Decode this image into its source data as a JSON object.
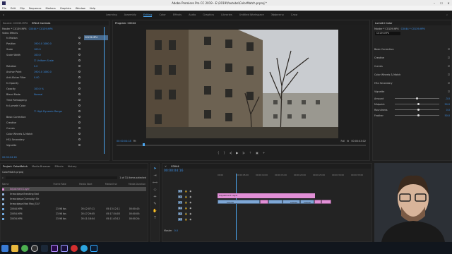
{
  "window": {
    "title": "Adobe Premiere Pro CC 2019 - E:\\2019\\Youtube\\ColorMatch.prproj *"
  },
  "menu": [
    "File",
    "Edit",
    "Clip",
    "Sequence",
    "Markers",
    "Graphics",
    "Window",
    "Help"
  ],
  "workspaces": {
    "items": [
      "Learning",
      "Assembly",
      "Editing",
      "Color",
      "Effects",
      "Audio",
      "Graphics",
      "Libraries",
      "Untitled Workspace",
      "Эффекты",
      "Слои"
    ],
    "active_index": 2
  },
  "effect_controls": {
    "tabs": [
      "Source: C0033.MP4",
      "Effect Controls",
      "Audio Clip Mixer: C0044",
      "Metadata"
    ],
    "master": "Master * C0139.MP4",
    "sequence": "C0044 * C0139.MP4",
    "clip_label": "C0139.MP4",
    "section": "Video Effects",
    "rows": [
      {
        "name": "fx Motion",
        "value": ""
      },
      {
        "name": "Position",
        "value": "1920.0   1080.0"
      },
      {
        "name": "Scale",
        "value": "100.0"
      },
      {
        "name": "Scale Width",
        "value": "100.0"
      },
      {
        "name": "",
        "value": "☑ Uniform Scale"
      },
      {
        "name": "Rotation",
        "value": "0.0"
      },
      {
        "name": "Anchor Point",
        "value": "1920.0   1080.0"
      },
      {
        "name": "Anti-flicker Filter",
        "value": "0.00"
      },
      {
        "name": "fx Opacity",
        "value": ""
      },
      {
        "name": "Opacity",
        "value": "100.0 %"
      },
      {
        "name": "Blend Mode",
        "value": "Normal"
      },
      {
        "name": "Time Remapping",
        "value": ""
      },
      {
        "name": "fx Lumetri Color",
        "value": ""
      },
      {
        "name": "",
        "value": "☐ High Dynamic Range"
      },
      {
        "name": "Basic Correction",
        "value": ""
      },
      {
        "name": "Creative",
        "value": ""
      },
      {
        "name": "Curves",
        "value": ""
      },
      {
        "name": "Color Wheels & Match",
        "value": ""
      },
      {
        "name": "HSL Secondary",
        "value": ""
      },
      {
        "name": "Vignette",
        "value": ""
      }
    ],
    "timecode": "00:00:04:18"
  },
  "program_monitor": {
    "title": "Program: C0044",
    "timecode_left": "00:00:04:18",
    "fit": "Fit",
    "quality": "Full",
    "timecode_right": "00:00:43:02"
  },
  "lumetri": {
    "title": "Lumetri Color",
    "master": "Master * C0139.MP4",
    "seq": "C0044 * C0139.MP4",
    "clip": "C0139.MP4",
    "sections": [
      "Basic Correction",
      "Creative",
      "Curves",
      "Color Wheels & Match",
      "HSL Secondary",
      "Vignette"
    ],
    "vignette": [
      {
        "label": "Amount",
        "value": "-3.0",
        "pos": 0.47
      },
      {
        "label": "Midpoint",
        "value": "50.0",
        "pos": 0.5
      },
      {
        "label": "Roundness",
        "value": "0.0",
        "pos": 0.5
      },
      {
        "label": "Feather",
        "value": "50.0",
        "pos": 0.5
      }
    ]
  },
  "project": {
    "tabs": [
      "Project: ColorMatch",
      "Media Browser",
      "Effects",
      "History"
    ],
    "file": "ColorMatch.prproj",
    "count": "1 of 31 items selected",
    "columns": [
      "Name",
      "Frame Rate",
      "Media Start",
      "Media End",
      "Media Duration"
    ],
    "items": [
      {
        "name": "Adjustment Layer",
        "rate": "",
        "start": "",
        "end": "",
        "dur": "",
        "color": "#e08ad4"
      },
      {
        "name": "Атмосфера Breaking Bad",
        "rate": "",
        "start": "",
        "end": "",
        "dur": "",
        "color": "#8fb3d9"
      },
      {
        "name": "Атмосфера Chernobyl Str",
        "rate": "",
        "start": "",
        "end": "",
        "dur": "",
        "color": "#8fb3d9"
      },
      {
        "name": "Атмосфера Mad Max_EX-F",
        "rate": "",
        "start": "",
        "end": "",
        "dur": "",
        "color": "#8fb3d9"
      },
      {
        "name": "C0044.MP4",
        "rate": "23.98 fps",
        "start": "05:12:07:11",
        "end": "05:13:12:11",
        "dur": "00:00:43:",
        "color": "#6ea4d8"
      },
      {
        "name": "C0054.MP4",
        "rate": "23.98 fps",
        "start": "05:17:29:05",
        "end": "05:17:34:03",
        "dur": "00:00:05:",
        "color": "#6ea4d8"
      },
      {
        "name": "C0034.MP4",
        "rate": "23.98 fps",
        "start": "05:11:18:04",
        "end": "05:11:43:12",
        "dur": "00:00:24:",
        "color": "#6ea4d8"
      }
    ]
  },
  "timeline": {
    "title": "C0044",
    "timecode": "00:00:04:16",
    "ruler": [
      "00:00",
      "00:00:05:00",
      "00:00:10:00",
      "00:00:15:00",
      "00:00:20:00",
      "00:00:25:00",
      "00:00:30:00",
      "00:00:35:00"
    ],
    "tracks": [
      "V3",
      "V2",
      "V1",
      "A1",
      "A2",
      "A3"
    ],
    "master": "Master",
    "master_value": "0.0",
    "adjustment_label": "Adjustment Layer",
    "clips": [
      "C0139",
      "C0044",
      "C0040",
      "C0033"
    ]
  },
  "taskbar": {
    "icons": [
      "windows-icon",
      "explorer-icon",
      "chrome-icon",
      "obs-icon",
      "steam-icon",
      "premiere-icon",
      "aftereffects-icon",
      "photoshop-icon",
      "telegram-icon",
      "opera-icon"
    ]
  }
}
